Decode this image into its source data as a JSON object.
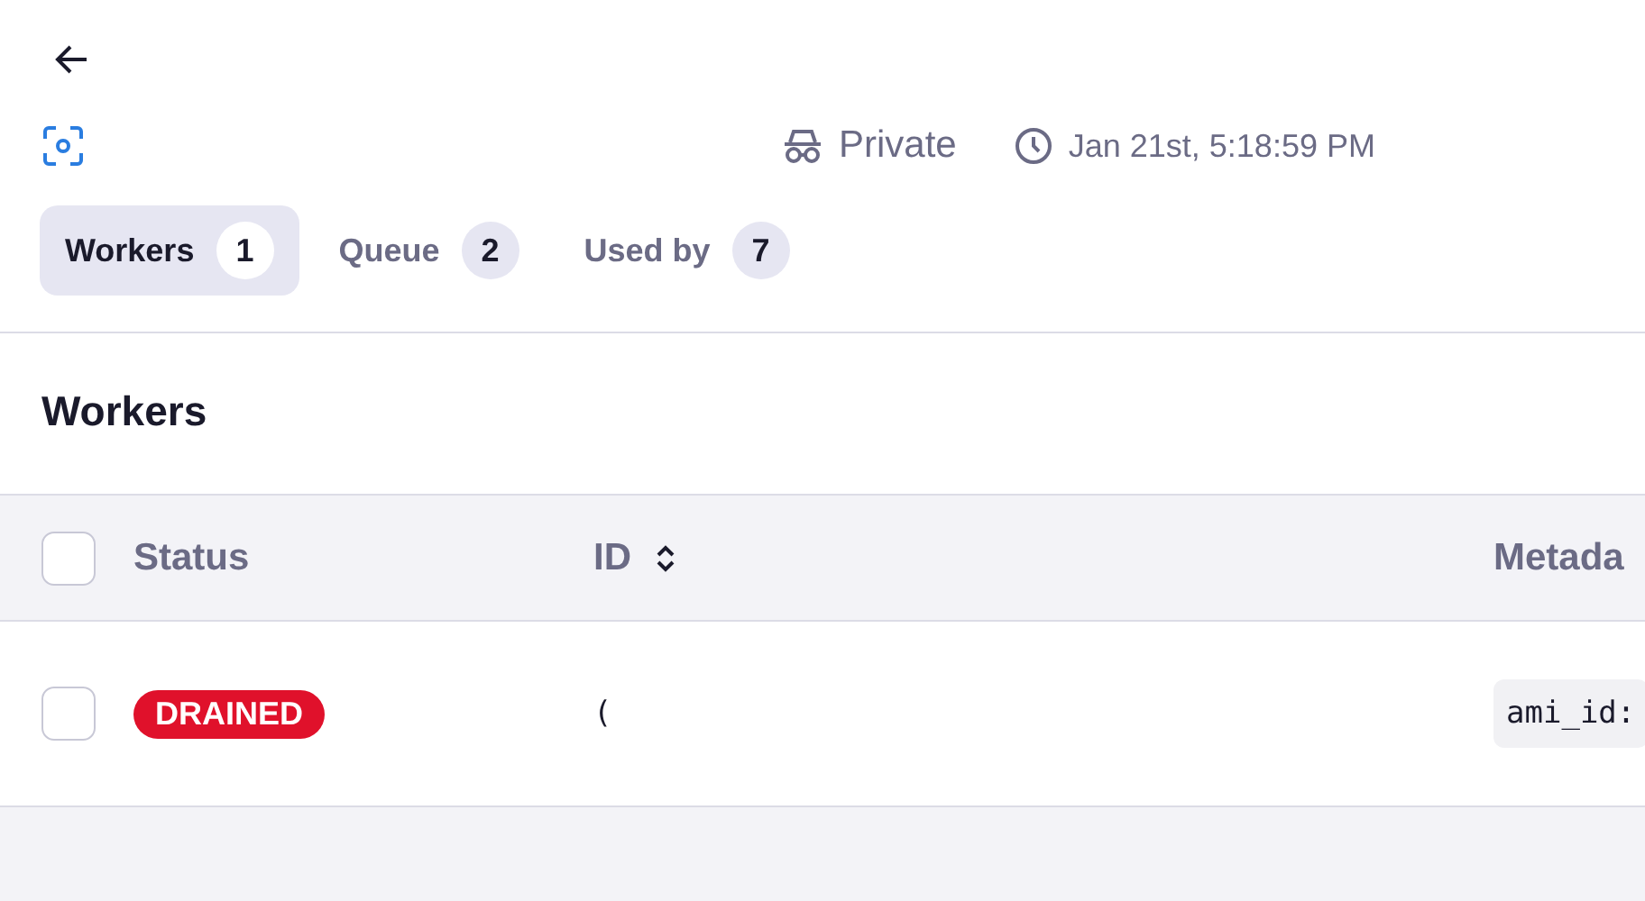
{
  "visibility": {
    "label": "Private"
  },
  "timestamp": "Jan 21st, 5:18:59 PM",
  "tabs": [
    {
      "label": "Workers",
      "count": "1",
      "selected": true
    },
    {
      "label": "Queue",
      "count": "2",
      "selected": false
    },
    {
      "label": "Used by",
      "count": "7",
      "selected": false
    }
  ],
  "section_title": "Workers",
  "table": {
    "select_all_checked": false,
    "columns": [
      {
        "label": "Status"
      },
      {
        "label": "ID",
        "sortable": true
      },
      {
        "label": "Metada"
      }
    ],
    "rows": [
      {
        "checked": false,
        "status": {
          "label": "DRAINED",
          "kind": "drained"
        },
        "id": "(",
        "metadata": "ami_id:"
      }
    ]
  }
}
